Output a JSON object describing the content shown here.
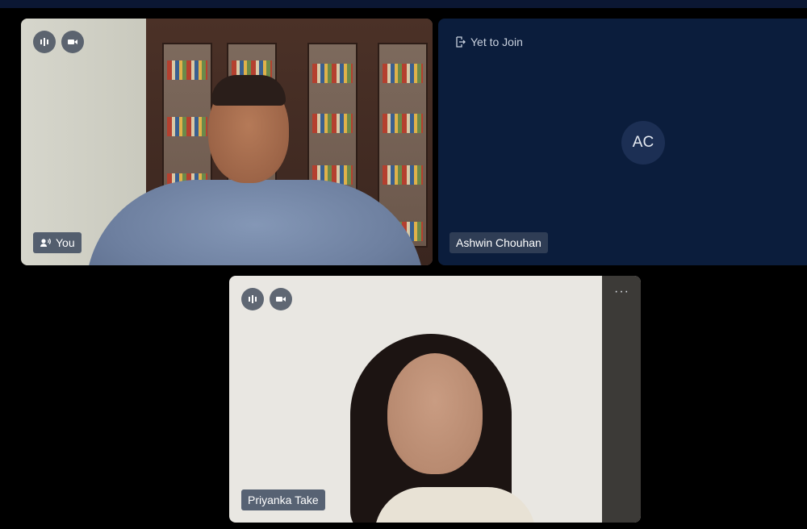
{
  "tiles": {
    "you": {
      "name": "You",
      "controls": {
        "audio_icon": "audio-level-icon",
        "video_icon": "video-camera-icon"
      }
    },
    "ashwin": {
      "name": "Ashwin Chouhan",
      "initials": "AC",
      "status": "Yet to Join"
    },
    "priyanka": {
      "name": "Priyanka Take",
      "more": "···",
      "controls": {
        "audio_icon": "audio-level-icon",
        "video_icon": "video-camera-icon"
      }
    }
  },
  "colors": {
    "background": "#000000",
    "empty_tile": "#0b1d3c",
    "avatar": "#1c2f54",
    "label_bg": "#37445a"
  }
}
